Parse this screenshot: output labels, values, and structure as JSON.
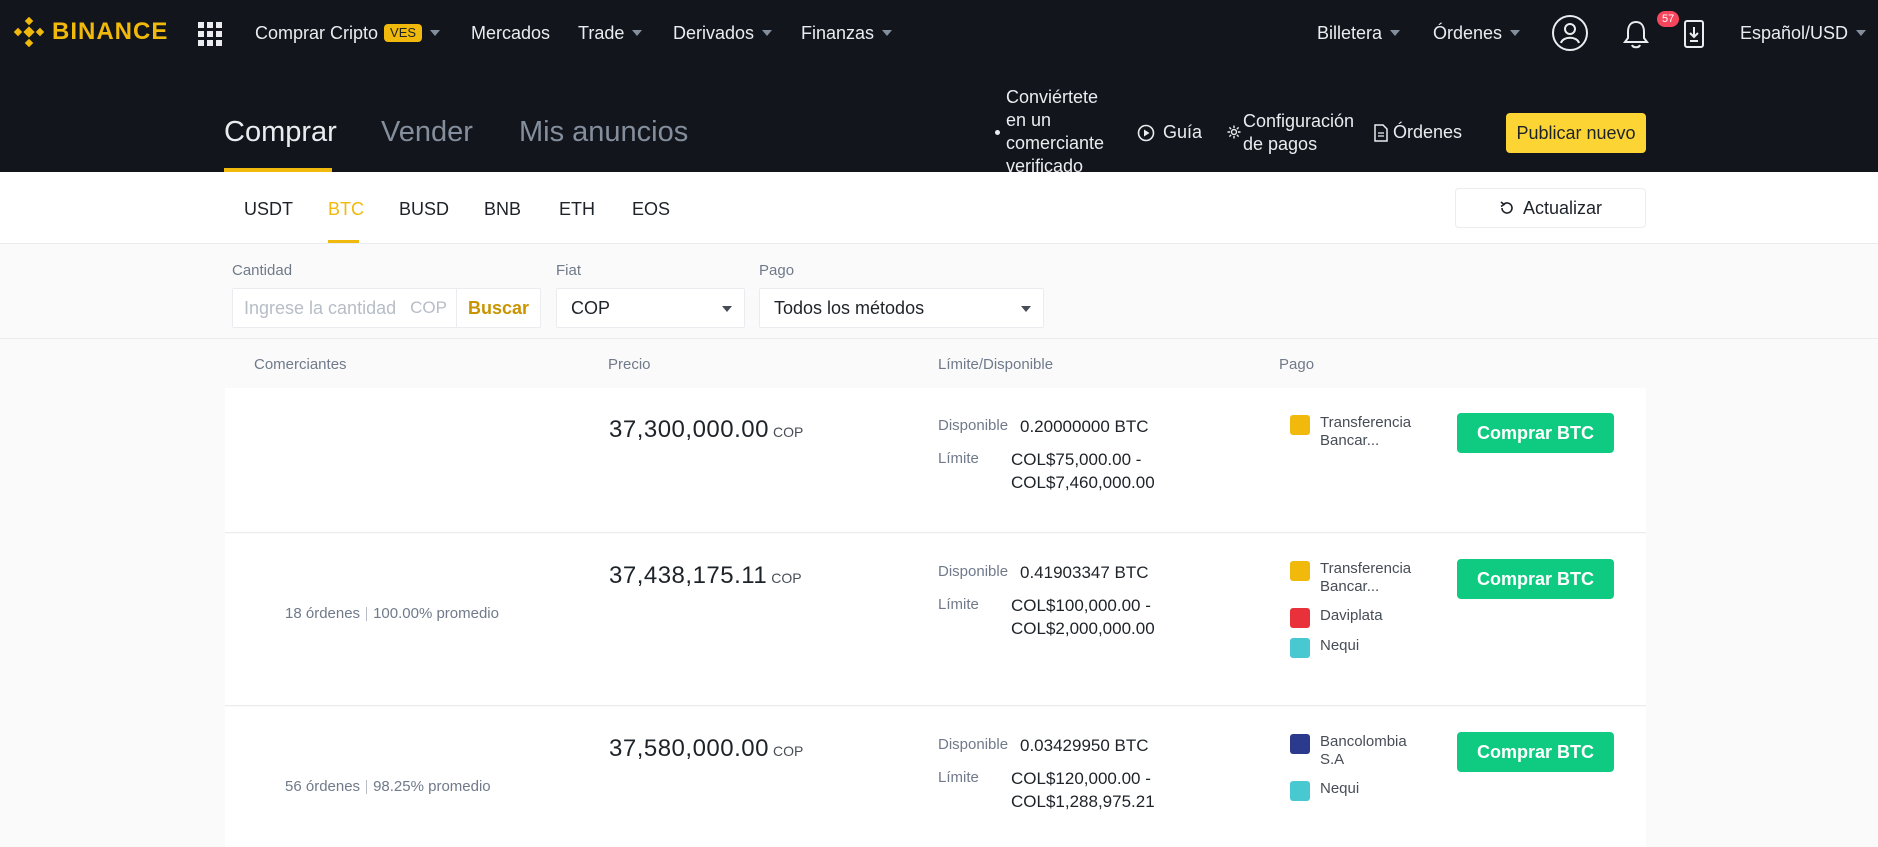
{
  "brand": {
    "name": "BINANCE",
    "accent": "#f0b90b"
  },
  "topnav": {
    "buy_crypto": "Comprar Cripto",
    "buy_crypto_badge": "VES",
    "markets": "Mercados",
    "trade": "Trade",
    "derivatives": "Derivados",
    "finance": "Finanzas",
    "wallet": "Billetera",
    "orders": "Órdenes",
    "notifications_count": "57",
    "language": "Español/USD"
  },
  "p2p_header": {
    "tabs": [
      "Comprar",
      "Vender",
      "Mis anuncios"
    ],
    "active_tab": "Comprar",
    "merchant_link": "Conviértete en un comerciante verificado",
    "guide": "Guía",
    "payment_config": "Configuración de pagos",
    "orders": "Órdenes",
    "publish": "Publicar nuevo"
  },
  "coins": {
    "tabs": [
      "USDT",
      "BTC",
      "BUSD",
      "BNB",
      "ETH",
      "EOS"
    ],
    "active": "BTC",
    "refresh": "Actualizar"
  },
  "filters": {
    "amount_label": "Cantidad",
    "amount_placeholder": "Ingrese la cantidad",
    "amount_unit": "COP",
    "search": "Buscar",
    "fiat_label": "Fiat",
    "fiat_value": "COP",
    "payment_label": "Pago",
    "payment_value": "Todos los métodos"
  },
  "table": {
    "headers": [
      "Comerciantes",
      "Precio",
      "Límite/Disponible",
      "Pago"
    ],
    "available_label": "Disponible",
    "limit_label": "Límite",
    "buy_label": "Comprar BTC",
    "rows": [
      {
        "orders": "",
        "completion": "",
        "price": "37,300,000.00",
        "currency": "COP",
        "available": "0.20000000 BTC",
        "limit_min": "COL$75,000.00 -",
        "limit_max": "COL$7,460,000.00",
        "payments": [
          {
            "name": "Transferencia Bancar...",
            "icon": "bank-transfer-icon",
            "color": "#f0b90b"
          }
        ]
      },
      {
        "orders": "18 órdenes",
        "completion": "100.00% promedio",
        "price": "37,438,175.11",
        "currency": "COP",
        "available": "0.41903347 BTC",
        "limit_min": "COL$100,000.00 -",
        "limit_max": "COL$2,000,000.00",
        "payments": [
          {
            "name": "Transferencia Bancar...",
            "icon": "bank-transfer-icon",
            "color": "#f0b90b"
          },
          {
            "name": "Daviplata",
            "icon": "daviplata-icon",
            "color": "#e8313a"
          },
          {
            "name": "Nequi",
            "icon": "nequi-icon",
            "color": "#48c9d2"
          }
        ]
      },
      {
        "orders": "56 órdenes",
        "completion": "98.25% promedio",
        "price": "37,580,000.00",
        "currency": "COP",
        "available": "0.03429950 BTC",
        "limit_min": "COL$120,000.00 -",
        "limit_max": "COL$1,288,975.21",
        "payments": [
          {
            "name": "Bancolombia S.A",
            "icon": "bancolombia-icon",
            "color": "#2b3a8c"
          },
          {
            "name": "Nequi",
            "icon": "nequi-icon",
            "color": "#48c9d2"
          }
        ]
      }
    ]
  }
}
